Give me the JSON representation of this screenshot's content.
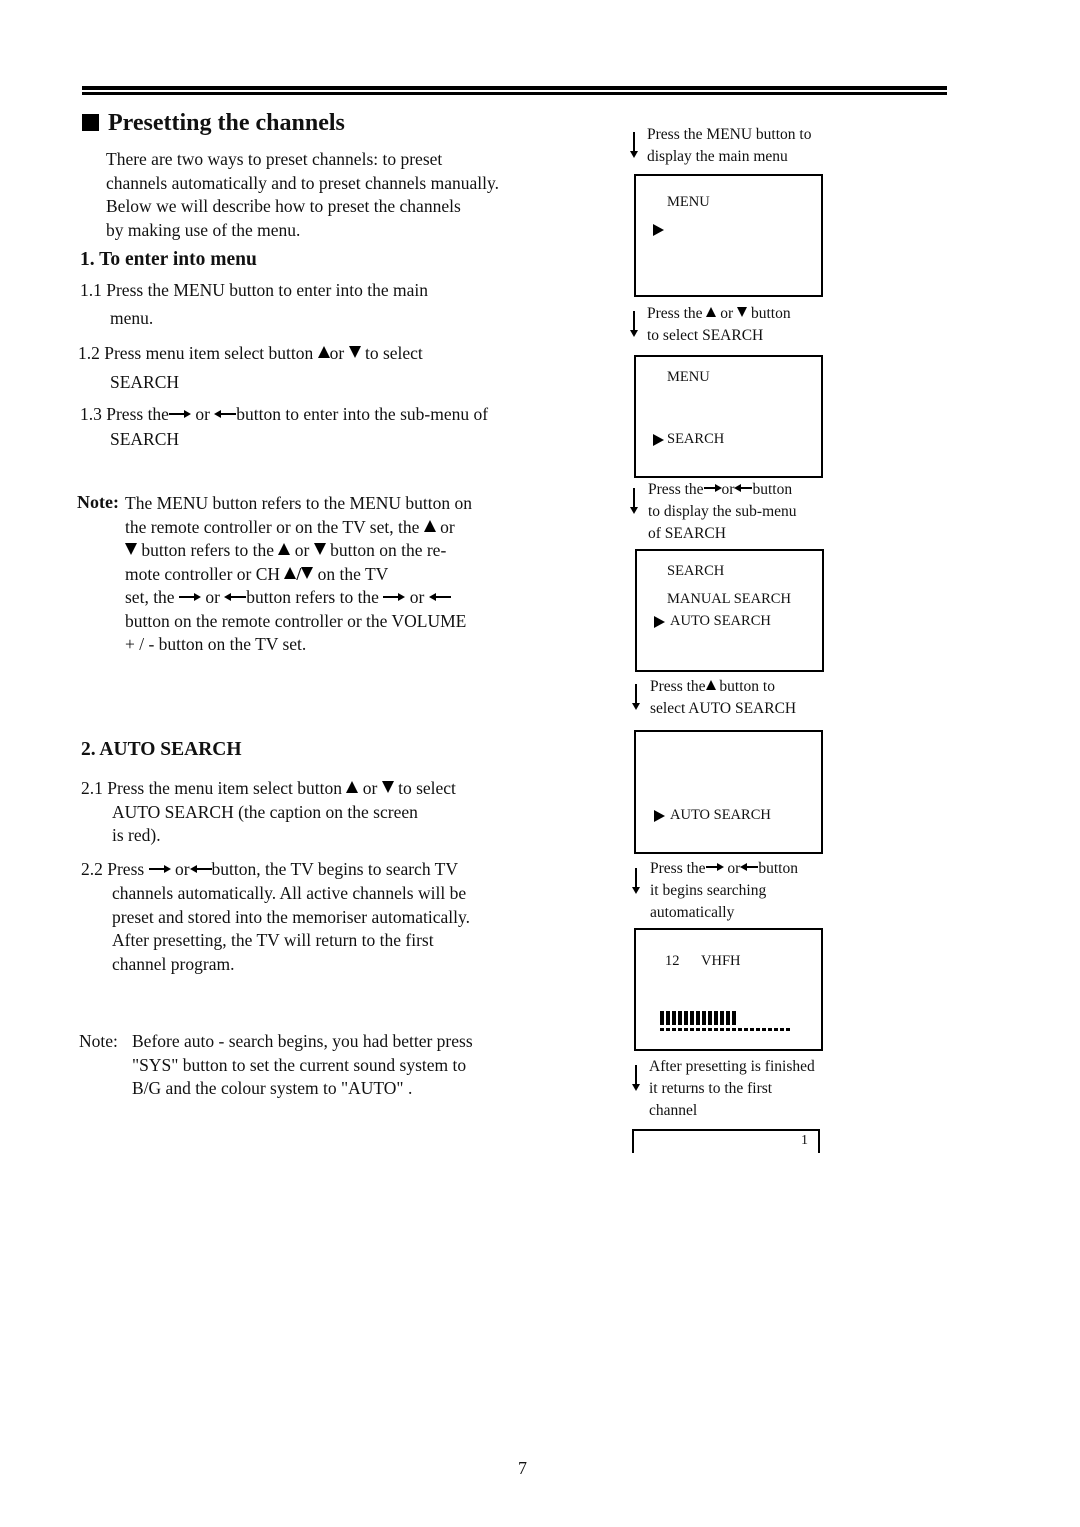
{
  "section_title": "Presetting the channels",
  "intro": [
    "There are two ways to preset channels: to preset",
    "channels automatically and to preset channels manually.",
    "Below we will describe how to preset the channels",
    "by making use of the menu."
  ],
  "part1": {
    "heading": "1. To enter into menu",
    "s11_num": "1.1",
    "s11_line1": "Press the MENU button to enter into the main",
    "s11_line2": "menu.",
    "s12_num": "1.2",
    "s12_a": "Press menu item select button ",
    "s12_or": "or",
    "s12_b": " to select",
    "s12_line2": "SEARCH",
    "s13_num": "1.3",
    "s13_a": "Press the",
    "s13_or": " or ",
    "s13_b": "button to enter into the sub-menu of",
    "s13_line2": "SEARCH"
  },
  "note1": {
    "label": "Note:",
    "l1": "The MENU button refers to the MENU button on",
    "l2a": "the remote controller or on the TV set, the ",
    "l2b": " or",
    "l3a": " button refers to the ",
    "l3b": " or ",
    "l3c": " button on the re-",
    "l4a": "mote controller or CH ",
    "l4slash": "/",
    "l4b": " on the TV",
    "l5a": "set, the ",
    "l5b": " or ",
    "l5c": "button refers to the ",
    "l5d": " or ",
    "l6": "button on the remote controller or the VOLUME",
    "l7": "+ / - button on the TV set."
  },
  "part2": {
    "heading": "2. AUTO SEARCH",
    "s21_num": "2.1",
    "s21_a": "Press the menu item select button ",
    "s21_or": " or ",
    "s21_b": " to select",
    "s21_l2": "AUTO SEARCH (the caption on the screen",
    "s21_l3": "is red).",
    "s22_num": "2.2",
    "s22_a": "Press ",
    "s22_or": " or",
    "s22_b": "button, the TV begins to search TV",
    "s22_l2": "channels automatically. All active channels will be",
    "s22_l3": "preset and stored into the memoriser automatically.",
    "s22_l4": "After presetting, the TV will return to the first",
    "s22_l5": "channel program."
  },
  "note2": {
    "label": "Note:",
    "l1": "Before auto - search begins, you had better press",
    "l2": "\"SYS\" button to set the current sound system to",
    "l3": "B/G and the colour system to \"AUTO\" ."
  },
  "steps": {
    "s1_l1": "Press the MENU button to",
    "s1_l2": "display the main menu",
    "s2_a": "Press the ",
    "s2_or": " or ",
    "s2_b": " button",
    "s2_l2": "to select SEARCH",
    "s3_a": "Press the",
    "s3_or": "or",
    "s3_b": "button",
    "s3_l2": "to display the sub-menu",
    "s3_l3": "of SEARCH",
    "s4_a": "Press the",
    "s4_b": " button to",
    "s4_l2": "select AUTO SEARCH",
    "s5_a": "Press the",
    "s5_or": " or",
    "s5_b": "button",
    "s5_l2": "it begins searching",
    "s5_l3": "automatically",
    "s6_l1": "After presetting is finished",
    "s6_l2": "it returns  to the first",
    "s6_l3": "channel"
  },
  "screens": {
    "menu1_title": "MENU",
    "menu2_title": "MENU",
    "menu2_item": "SEARCH",
    "sub_title": "SEARCH",
    "sub_item1": "MANUAL SEARCH",
    "sub_item2": "AUTO SEARCH",
    "auto_item": "AUTO SEARCH",
    "search_channel": "12",
    "search_band": "VHFH",
    "search_progress": {
      "filled": 13,
      "total": 22
    },
    "final_channel": "1"
  },
  "page_number": "7"
}
